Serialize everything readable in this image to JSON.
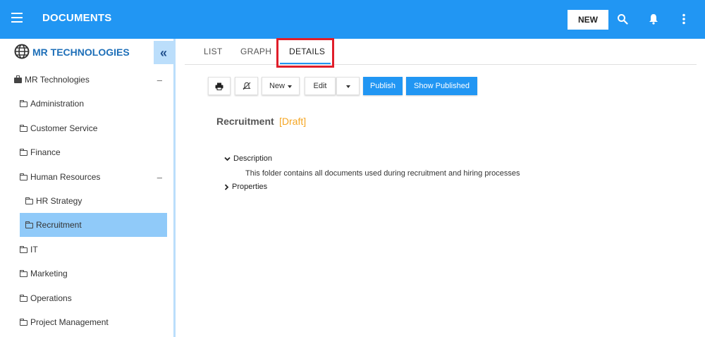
{
  "header": {
    "title": "DOCUMENTS",
    "new_label": "NEW",
    "accent_color": "#2196f3"
  },
  "sidebar": {
    "org_title": "MR TECHNOLOGIES",
    "collapse_glyph": "«",
    "tree": [
      {
        "label": "MR Technologies",
        "icon": "briefcase-icon",
        "expanded": true
      },
      {
        "label": "Administration",
        "icon": "folder-icon"
      },
      {
        "label": "Customer Service",
        "icon": "folder-icon"
      },
      {
        "label": "Finance",
        "icon": "folder-icon"
      },
      {
        "label": "Human Resources",
        "icon": "folder-icon",
        "expanded": true
      },
      {
        "label": "HR Strategy",
        "icon": "folder-icon"
      },
      {
        "label": "Recruitment",
        "icon": "folder-icon",
        "selected": true
      },
      {
        "label": "IT",
        "icon": "folder-icon"
      },
      {
        "label": "Marketing",
        "icon": "folder-icon"
      },
      {
        "label": "Operations",
        "icon": "folder-icon"
      },
      {
        "label": "Project Management",
        "icon": "folder-icon"
      }
    ],
    "collapse_minus": "–"
  },
  "tabs": [
    {
      "label": "LIST"
    },
    {
      "label": "GRAPH"
    },
    {
      "label": "DETAILS",
      "active": true
    }
  ],
  "toolbar": {
    "new_label": "New",
    "edit_label": "Edit",
    "publish_label": "Publish",
    "show_published_label": "Show Published"
  },
  "details": {
    "title": "Recruitment",
    "status": "[Draft]",
    "status_color": "#f5a623",
    "description_label": "Description",
    "description_text": "This folder contains all documents used during recruitment and hiring processes",
    "properties_label": "Properties"
  }
}
